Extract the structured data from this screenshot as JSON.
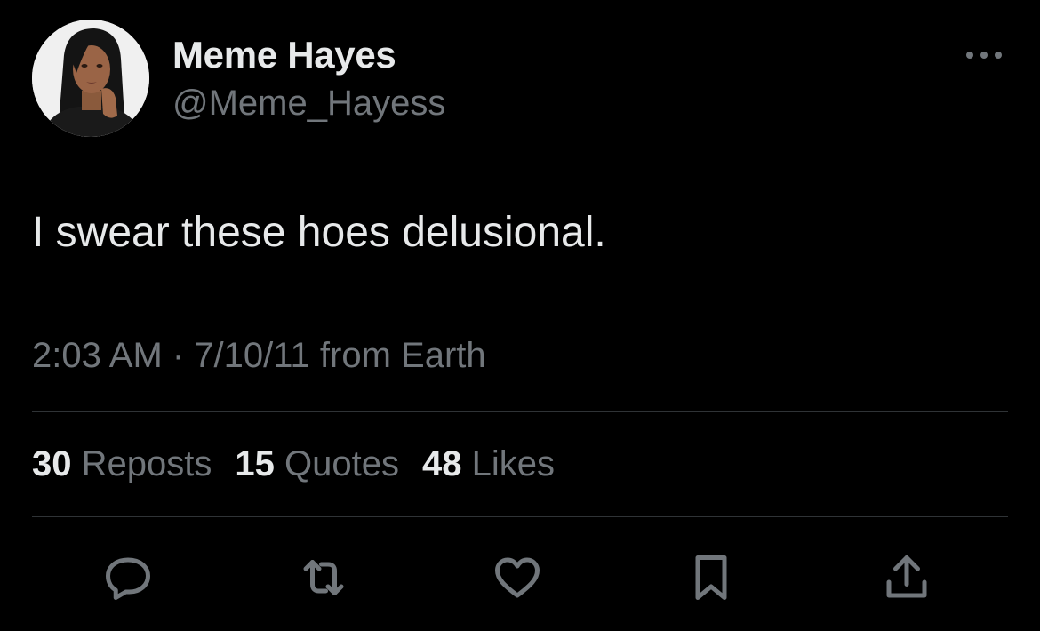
{
  "user": {
    "display_name": "Meme Hayes",
    "handle": "@Meme_Hayess"
  },
  "tweet": {
    "text": "I swear these hoes delusional.",
    "meta": "2:03 AM · 7/10/11 from Earth"
  },
  "stats": {
    "reposts_count": "30",
    "reposts_label": "Reposts",
    "quotes_count": "15",
    "quotes_label": "Quotes",
    "likes_count": "48",
    "likes_label": "Likes"
  },
  "icons": {
    "more": "more-horizontal-icon",
    "reply": "reply-icon",
    "repost": "repost-icon",
    "like": "heart-icon",
    "bookmark": "bookmark-icon",
    "share": "share-icon"
  },
  "colors": {
    "background": "#000000",
    "text_primary": "#e7e9ea",
    "text_secondary": "#71767b",
    "divider": "#2f3336"
  }
}
